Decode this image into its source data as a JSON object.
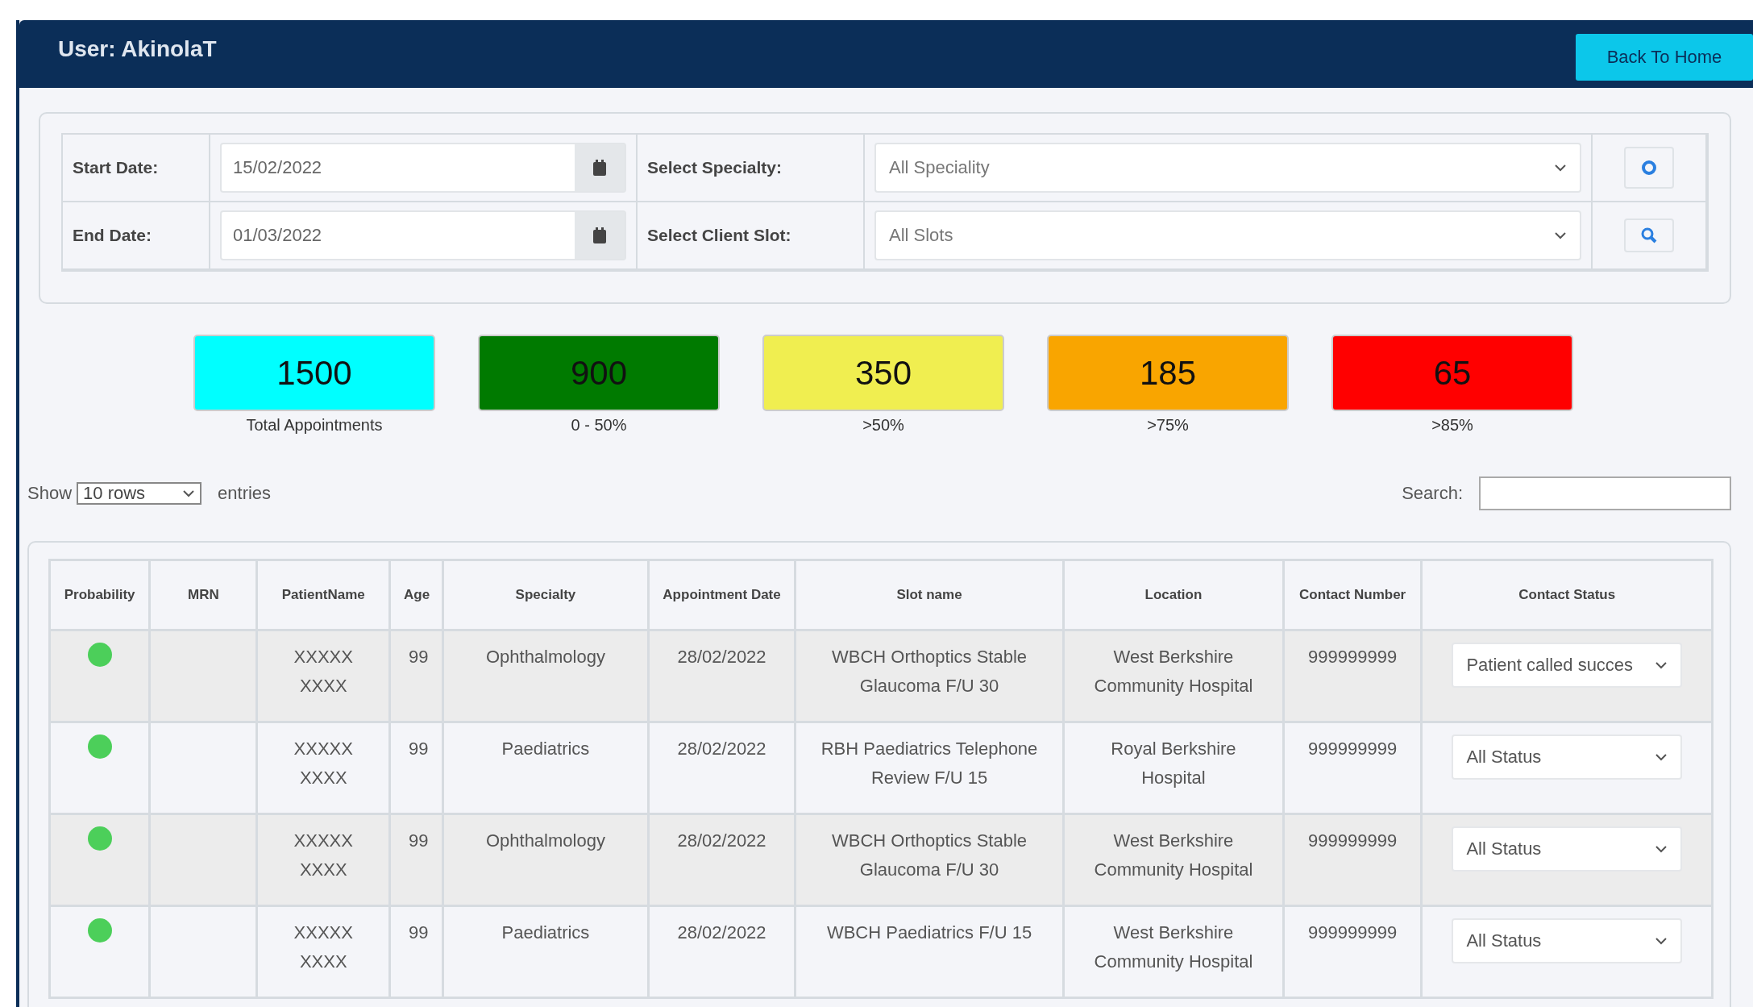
{
  "header": {
    "user": "User: AkinolaT",
    "back_button": "Back To Home"
  },
  "filters": {
    "start_label": "Start Date:",
    "start_value": "15/02/2022",
    "end_label": "End Date:",
    "end_value": "01/03/2022",
    "specialty_label": "Select Specialty:",
    "specialty_value": "All Speciality",
    "slot_label": "Select Client Slot:",
    "slot_value": "All Slots"
  },
  "stats": [
    {
      "value": "1500",
      "label": "Total Appointments",
      "color": "#00ffff"
    },
    {
      "value": "900",
      "label": "0 - 50%",
      "color": "#007a00"
    },
    {
      "value": "350",
      "label": ">50%",
      "color": "#f0ee50"
    },
    {
      "value": "185",
      "label": ">75%",
      "color": "#f9a500"
    },
    {
      "value": "65",
      "label": ">85%",
      "color": "#ff0000"
    }
  ],
  "entries": {
    "show": "Show",
    "rows_value": "10 rows",
    "suffix": "entries",
    "search_label": "Search:"
  },
  "table": {
    "columns": [
      "Probability",
      "MRN",
      "PatientName",
      "Age",
      "Specialty",
      "Appointment Date",
      "Slot name",
      "Location",
      "Contact Number",
      "Contact Status"
    ],
    "rows": [
      {
        "color": "#4ccf5a",
        "patient": "XXXXX XXXX",
        "age": "99",
        "specialty": "Ophthalmology",
        "date": "28/02/2022",
        "slot": "WBCH Orthoptics Stable Glaucoma F/U 30",
        "location": "West Berkshire Community Hospital",
        "contact": "999999999",
        "status": "Patient called succes"
      },
      {
        "color": "#4ccf5a",
        "patient": "XXXXX XXXX",
        "age": "99",
        "specialty": "Paediatrics",
        "date": "28/02/2022",
        "slot": "RBH Paediatrics Telephone Review F/U 15",
        "location": "Royal Berkshire Hospital",
        "contact": "999999999",
        "status": "All Status"
      },
      {
        "color": "#4ccf5a",
        "patient": "XXXXX XXXX",
        "age": "99",
        "specialty": "Ophthalmology",
        "date": "28/02/2022",
        "slot": "WBCH Orthoptics Stable Glaucoma F/U 30",
        "location": "West Berkshire Community Hospital",
        "contact": "999999999",
        "status": "All Status"
      },
      {
        "color": "#4ccf5a",
        "patient": "XXXXX XXXX",
        "age": "99",
        "specialty": "Paediatrics",
        "date": "28/02/2022",
        "slot": "WBCH Paediatrics F/U 15",
        "location": "West Berkshire Community Hospital",
        "contact": "999999999",
        "status": "All Status"
      }
    ]
  }
}
